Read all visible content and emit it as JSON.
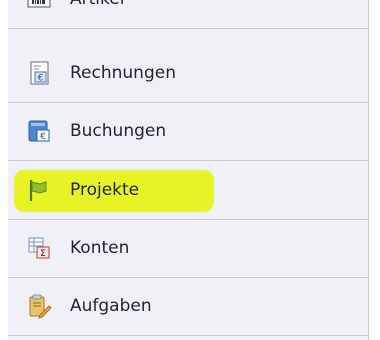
{
  "sidebar": {
    "items": [
      {
        "label": "Artikel",
        "icon": "barcode-icon"
      },
      {
        "label": "Rechnungen",
        "icon": "invoice-euro-icon"
      },
      {
        "label": "Buchungen",
        "icon": "booking-euro-icon"
      },
      {
        "label": "Projekte",
        "icon": "flag-icon",
        "highlighted": true
      },
      {
        "label": "Konten",
        "icon": "accounts-sum-icon"
      },
      {
        "label": "Aufgaben",
        "icon": "tasks-clipboard-icon"
      }
    ]
  },
  "colors": {
    "panel_bg": "#eff1f7",
    "divider": "#c7cbd5",
    "highlight": "#e6f400",
    "flag_green": "#6f9a1c"
  }
}
